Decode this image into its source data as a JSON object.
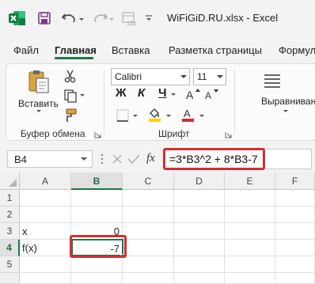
{
  "titlebar": {
    "title": "WiFiGiD.RU.xlsx  -  Excel",
    "app_icon": "excel-icon",
    "qat": [
      "save-icon",
      "undo-icon",
      "redo-icon",
      "number-format-icon"
    ]
  },
  "tabs": [
    {
      "label": "Файл",
      "active": false
    },
    {
      "label": "Главная",
      "active": true
    },
    {
      "label": "Вставка",
      "active": false
    },
    {
      "label": "Разметка страницы",
      "active": false
    },
    {
      "label": "Формул",
      "active": false
    }
  ],
  "ribbon": {
    "clipboard": {
      "paste_label": "Вставить",
      "group_label": "Буфер обмена",
      "icons": [
        "paste-icon",
        "cut-icon",
        "copy-icon",
        "format-painter-icon"
      ]
    },
    "font": {
      "font_name": "Calibri",
      "font_size": "11",
      "bold": "Ж",
      "italic": "К",
      "underline": "Ч",
      "group_label": "Шрифт",
      "icons": [
        "increase-font-icon",
        "decrease-font-icon",
        "borders-icon",
        "fill-color-icon",
        "font-color-icon"
      ]
    },
    "alignment": {
      "label": "Выравнивание",
      "icon": "align-icon"
    }
  },
  "formula_bar": {
    "name_box": "B4",
    "fx": "fx",
    "formula": "=3*B3^2 + 8*B3-7"
  },
  "grid": {
    "columns": [
      "A",
      "B",
      "C",
      "D",
      "E",
      "F"
    ],
    "selected_column": "B",
    "rows": [
      {
        "num": "1",
        "a": "",
        "b": ""
      },
      {
        "num": "2",
        "a": "",
        "b": ""
      },
      {
        "num": "3",
        "a": "x",
        "b": "0"
      },
      {
        "num": "4",
        "a": "f(x)",
        "b": "-7"
      },
      {
        "num": "5",
        "a": "",
        "b": ""
      }
    ],
    "selected_row": "4",
    "active_cell": "B4"
  },
  "colors": {
    "accent_green": "#217346",
    "highlight_red": "#d32f2f",
    "fill_yellow": "#ffd200",
    "font_red": "#d32f2f"
  }
}
